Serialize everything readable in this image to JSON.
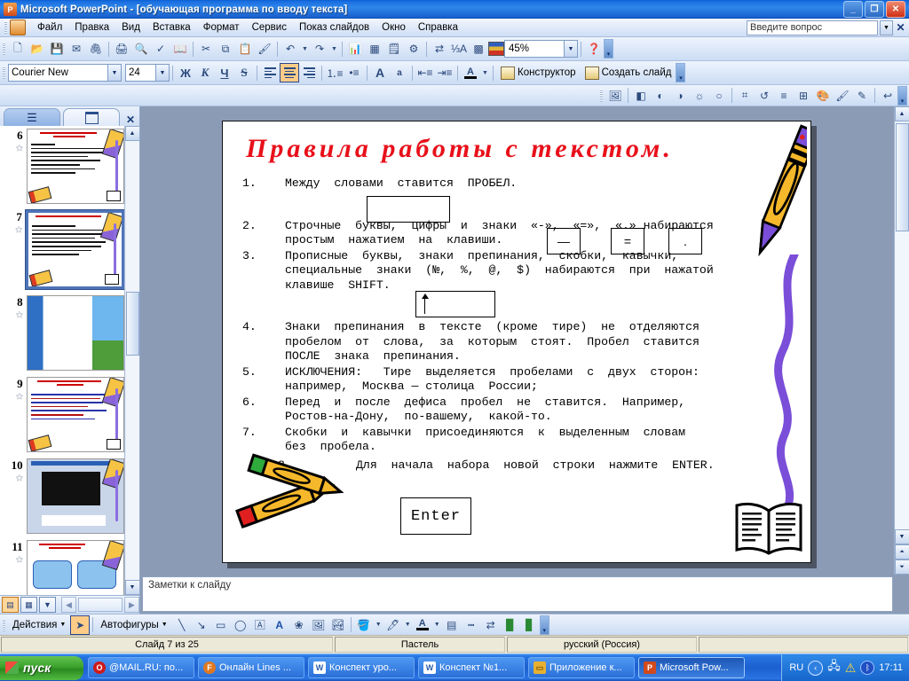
{
  "window": {
    "title": "Microsoft PowerPoint - [обучающая программа по вводу текста]",
    "app_icon": "powerpoint-icon",
    "minimize": "_",
    "restore": "❐",
    "close": "✕"
  },
  "menu": {
    "items": [
      {
        "label": "Файл"
      },
      {
        "label": "Правка"
      },
      {
        "label": "Вид"
      },
      {
        "label": "Вставка"
      },
      {
        "label": "Формат"
      },
      {
        "label": "Сервис"
      },
      {
        "label": "Показ слайдов"
      },
      {
        "label": "Окно"
      },
      {
        "label": "Справка"
      }
    ],
    "help_placeholder": "Введите вопрос",
    "help_close": "✕"
  },
  "standard_toolbar": {
    "zoom_value": "45%",
    "buttons": [
      "new-document-icon",
      "open-folder-icon",
      "save-icon",
      "email-icon",
      "attach-icon",
      "print-icon",
      "print-preview-icon",
      "spellcheck-icon",
      "research-icon",
      "cut-icon",
      "copy-icon",
      "paste-icon",
      "format-painter-icon",
      "undo-icon",
      "redo-icon",
      "insert-chart-icon",
      "insert-table-icon",
      "insert-diagram-icon",
      "expand-icon",
      "show-formatting-icon",
      "highlight-icon",
      "grid-icon",
      "color-scheme-icon",
      "help-icon"
    ]
  },
  "formatting_toolbar": {
    "font_name": "Courier New",
    "font_size": "24",
    "bold": "Ж",
    "italic": "К",
    "underline": "Ч",
    "shadow": "S",
    "align_left": "align-left-icon",
    "align_center": "align-center-icon",
    "align_right": "align-right-icon",
    "numbering": "numbered-list-icon",
    "bullets": "bulleted-list-icon",
    "increase_font": "A",
    "decrease_font": "a",
    "decrease_indent": "decrease-indent-icon",
    "increase_indent": "increase-indent-icon",
    "font_color": "A",
    "design_label": "Конструктор",
    "new_slide_label": "Создать слайд"
  },
  "left_panel": {
    "tab_outline": "outline-tab-icon",
    "tab_slides": "slides-tab-icon",
    "close": "✕",
    "thumbnails": [
      {
        "number": "6",
        "selected": false
      },
      {
        "number": "7",
        "selected": true
      },
      {
        "number": "8",
        "selected": false
      },
      {
        "number": "9",
        "selected": false
      },
      {
        "number": "10",
        "selected": false
      },
      {
        "number": "11",
        "selected": false
      }
    ],
    "view_buttons": [
      "normal-view-icon",
      "slide-sorter-icon",
      "slide-show-icon"
    ]
  },
  "slide": {
    "title": "Правила работы с текстом.",
    "rules": [
      {
        "num": "1.",
        "text": "Между  словами  ставится  ПРОБЕЛ."
      },
      {
        "num": "2.",
        "text": "Строчные  буквы,  цифры  и  знаки  «-»,  «=»,  «.» набираются\nпростым  нажатием  на  клавиши."
      },
      {
        "num": "3.",
        "text": "Прописные  буквы,  знаки  препинания,  скобки,  кавычки,\nспециальные  знаки  (№,  %,  @,  $)  набираются  при  нажатой\nклавише  SHIFT."
      },
      {
        "num": "4.",
        "text": "Знаки  препинания  в  тексте  (кроме  тире)  не  отделяются\nпробелом  от  слова,  за  которым  стоят.  Пробел  ставится\nПОСЛЕ  знака  препинания."
      },
      {
        "num": "5.",
        "text": "ИСКЛЮЧЕНИЯ:   Тире  выделяется  пробелами  с  двух  сторон:\nнапример,  Москва — столица  России;"
      },
      {
        "num": "6.",
        "text": "Перед  и  после  дефиса  пробел  не  ставится.  Например,\nРостов-на-Дону,  по-вашему,  какой-то."
      },
      {
        "num": "7.",
        "text": "Скобки  и  кавычки  присоединяются  к  выделенным  словам\nбез  пробела."
      },
      {
        "num": "8.",
        "text": "Для  начала  набора  новой  строки  нажмите  ENTER."
      }
    ],
    "key_dash": "—",
    "key_equals": "=",
    "key_dot": ".",
    "key_enter": "Enter",
    "clipart": [
      "crayon-icon",
      "squiggle-icon",
      "pencils-icon",
      "open-book-icon"
    ]
  },
  "notes": {
    "placeholder": "Заметки к слайду"
  },
  "drawing_toolbar": {
    "actions_label": "Действия",
    "autoshapes_label": "Автофигуры",
    "tools": [
      "select-arrow-icon",
      "line-icon",
      "arrow-icon",
      "rectangle-icon",
      "oval-icon",
      "text-box-icon",
      "wordart-icon",
      "diagram-icon",
      "clipart-icon",
      "picture-icon",
      "fill-color-icon",
      "line-color-icon",
      "font-color-icon",
      "line-style-icon",
      "dash-style-icon",
      "arrow-style-icon",
      "shadow-style-icon",
      "3d-style-icon"
    ]
  },
  "status_bar": {
    "slide_counter": "Слайд 7 из 25",
    "design_template": "Пастель",
    "language": "русский (Россия)"
  },
  "taskbar": {
    "start_label": "пуск",
    "items": [
      {
        "label": "@MAIL.RU: по...",
        "icon": "opera-icon",
        "color": "#cf1a1a",
        "active": false
      },
      {
        "label": "Онлайн Lines ...",
        "icon": "firefox-icon",
        "color": "#e07820",
        "active": false
      },
      {
        "label": "Конспект уро...",
        "icon": "word-icon",
        "color": "#2a5caa",
        "active": false
      },
      {
        "label": "Конспект №1...",
        "icon": "word-icon",
        "color": "#2a5caa",
        "active": false
      },
      {
        "label": "Приложение к...",
        "icon": "folder-icon",
        "color": "#e8b030",
        "active": false
      },
      {
        "label": "Microsoft Pow...",
        "icon": "powerpoint-icon",
        "color": "#d1491c",
        "active": true
      }
    ],
    "language_indicator": "RU",
    "tray_icons": [
      "update-icon",
      "network-icon",
      "warning-icon",
      "bluetooth-icon"
    ],
    "clock": "17:11"
  }
}
